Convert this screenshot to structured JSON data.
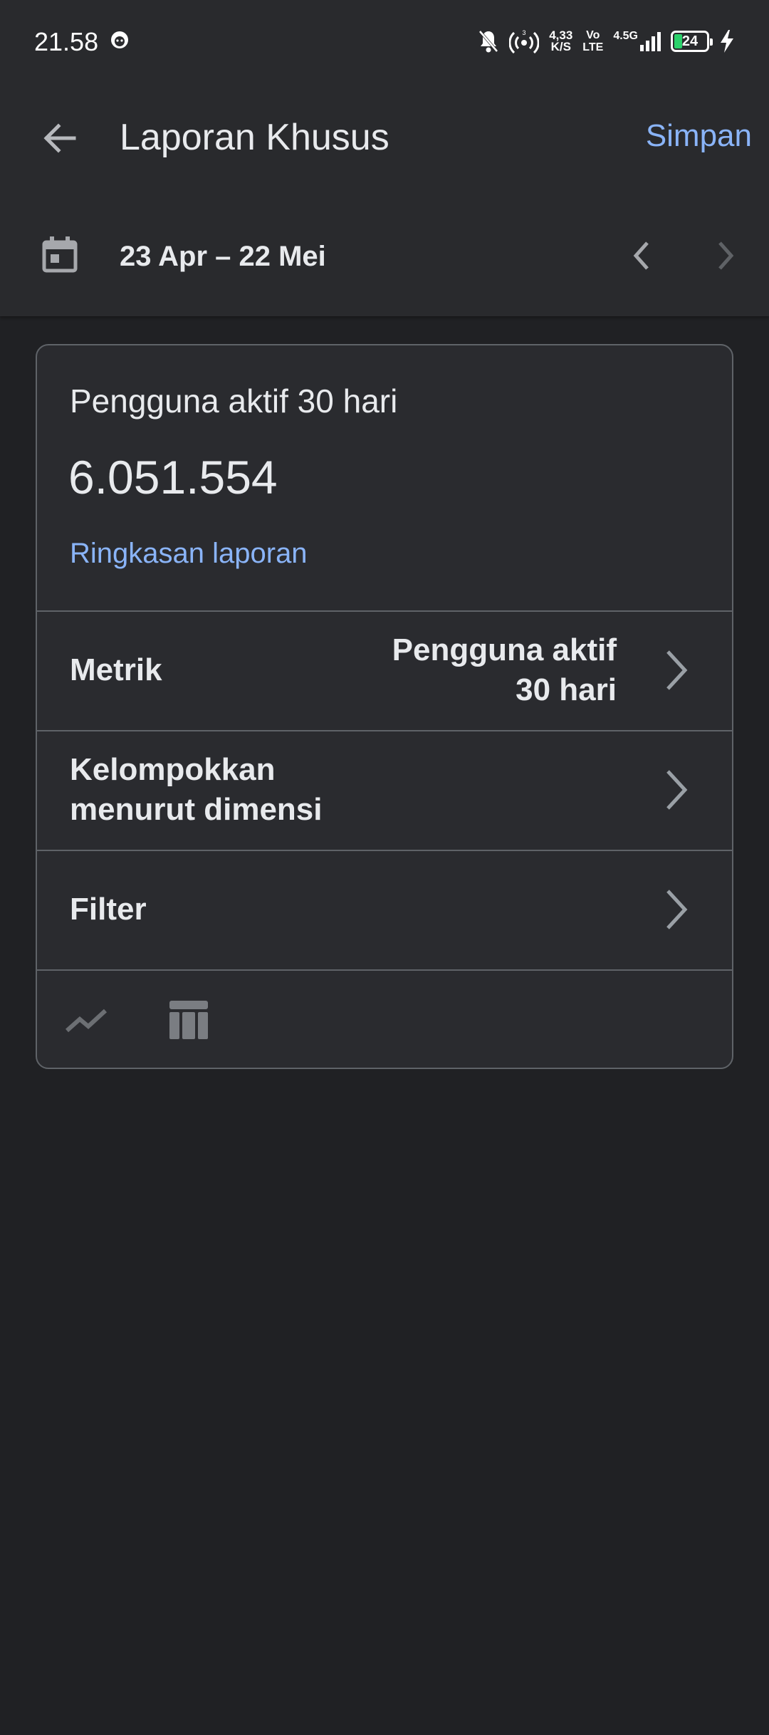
{
  "status_bar": {
    "time": "21.58",
    "speed_value": "4,33",
    "speed_unit": "K/S",
    "volte_top": "Vo",
    "volte_bottom": "LTE",
    "network": "4.5G",
    "battery": "24"
  },
  "app_bar": {
    "title": "Laporan Khusus",
    "save_label": "Simpan"
  },
  "date_bar": {
    "range": "23 Apr – 22 Mei"
  },
  "card": {
    "metric_name": "Pengguna aktif 30 hari",
    "metric_value": "6.051.554",
    "summary_link": "Ringkasan laporan",
    "rows": [
      {
        "label": "Metrik",
        "value": "Pengguna aktif 30 hari"
      },
      {
        "label": "Kelompokkan menurut dimensi",
        "value": ""
      },
      {
        "label": "Filter",
        "value": ""
      }
    ]
  },
  "colors": {
    "background": "#202124",
    "header": "#292a2d",
    "card": "#2a2b2f",
    "accent": "#8ab4f8",
    "divider": "#5f6368",
    "battery_fill": "#2bd26b"
  },
  "icons": {
    "back": "arrow-left-icon",
    "calendar": "calendar-icon",
    "prev": "chevron-left-icon",
    "next": "chevron-right-icon",
    "row": "chevron-right-icon",
    "line_chart": "line-chart-icon",
    "table": "table-icon"
  }
}
